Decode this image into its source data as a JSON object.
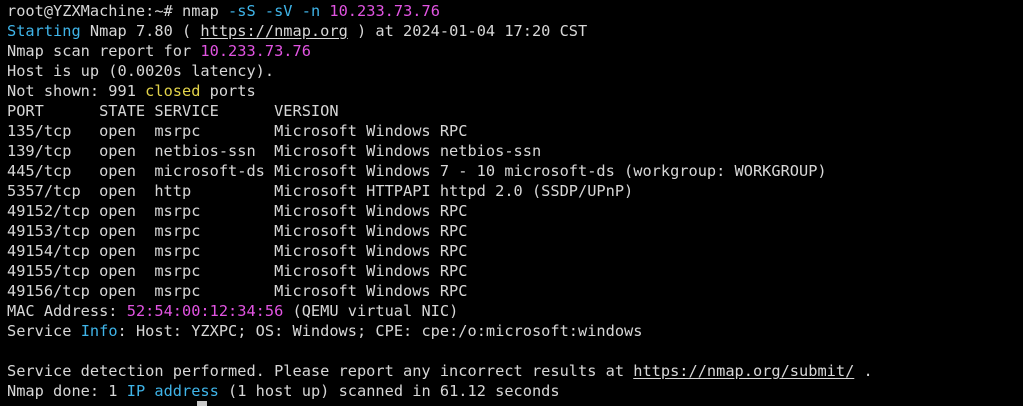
{
  "window": {
    "title": "root@YZXMachine:~"
  },
  "colors": {
    "background": "#000000",
    "foreground": "#d7d7d7",
    "magenta": "#e254e2",
    "cyan": "#3fb4e8",
    "yellow": "#e2d34a",
    "cursor": "#c8c8c8"
  },
  "terminal": {
    "prompt": "root@YZXMachine:~#",
    "command": "nmap -sS -sV -n 10.233.73.76",
    "lines": [
      [
        {
          "text": "root@YZXMachine:~# nmap "
        },
        {
          "text": "-sS",
          "color": "cyan"
        },
        {
          "text": " "
        },
        {
          "text": "-sV",
          "color": "cyan"
        },
        {
          "text": " "
        },
        {
          "text": "-n",
          "color": "cyan"
        },
        {
          "text": " "
        },
        {
          "text": "10.233.73.76",
          "color": "magenta"
        }
      ],
      [
        {
          "text": "Starting",
          "color": "cyan"
        },
        {
          "text": " Nmap 7.80 ( "
        },
        {
          "text": "https://nmap.org",
          "link": true
        },
        {
          "text": " ) at 2024-01-04 17:20 CST"
        }
      ],
      [
        {
          "text": "Nmap scan report for "
        },
        {
          "text": "10.233.73.76",
          "color": "magenta"
        }
      ],
      [
        {
          "text": "Host is up (0.0020s latency)."
        }
      ],
      [
        {
          "text": "Not shown: 991 "
        },
        {
          "text": "closed",
          "color": "yellow"
        },
        {
          "text": " ports"
        }
      ],
      [
        {
          "text": "PORT      STATE SERVICE      VERSION"
        }
      ],
      [
        {
          "text": "135/tcp   open  msrpc        Microsoft Windows RPC"
        }
      ],
      [
        {
          "text": "139/tcp   open  netbios-ssn  Microsoft Windows netbios-ssn"
        }
      ],
      [
        {
          "text": "445/tcp   open  microsoft-ds Microsoft Windows 7 - 10 microsoft-ds (workgroup: WORKGROUP)"
        }
      ],
      [
        {
          "text": "5357/tcp  open  http         Microsoft HTTPAPI httpd 2.0 (SSDP/UPnP)"
        }
      ],
      [
        {
          "text": "49152/tcp open  msrpc        Microsoft Windows RPC"
        }
      ],
      [
        {
          "text": "49153/tcp open  msrpc        Microsoft Windows RPC"
        }
      ],
      [
        {
          "text": "49154/tcp open  msrpc        Microsoft Windows RPC"
        }
      ],
      [
        {
          "text": "49155/tcp open  msrpc        Microsoft Windows RPC"
        }
      ],
      [
        {
          "text": "49156/tcp open  msrpc        Microsoft Windows RPC"
        }
      ],
      [
        {
          "text": "MAC Address: "
        },
        {
          "text": "52:54:00:12:34:56",
          "color": "magenta"
        },
        {
          "text": " (QEMU virtual NIC)"
        }
      ],
      [
        {
          "text": "Service "
        },
        {
          "text": "Info",
          "color": "cyan"
        },
        {
          "text": ": Host: YZXPC; OS: Windows; CPE: cpe:/o:microsoft:windows"
        }
      ],
      [
        {
          "text": ""
        }
      ],
      [
        {
          "text": "Service detection performed. Please report any incorrect results at "
        },
        {
          "text": "https://nmap.org/submit/",
          "link": true
        },
        {
          "text": " ."
        }
      ],
      [
        {
          "text": "Nmap done: 1 "
        },
        {
          "text": "IP address",
          "color": "cyan"
        },
        {
          "text": " (1 host up) scanned in 61.12 seconds"
        }
      ]
    ]
  }
}
